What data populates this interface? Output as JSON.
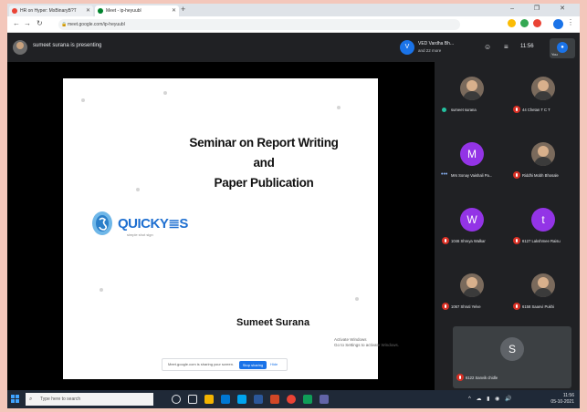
{
  "browser": {
    "tabs": [
      {
        "title": "HR on Hyper: MxBinaryB?T"
      },
      {
        "title": "Meet - ip-heyuubl"
      }
    ],
    "new_tab": "+",
    "window_controls": "– ❐ ✕",
    "address": "meet.google.com/ip-heyuubl"
  },
  "meet": {
    "presenting_text": "sumeet surana is presenting",
    "pinned": {
      "initial": "V",
      "name": "VED Vardha Bh...",
      "sub": "and 22 more"
    },
    "time": "11:56",
    "self_label": "You"
  },
  "slide": {
    "title_lines": [
      "Seminar on Report Writing",
      "and",
      "Paper Publication"
    ],
    "logo_text": "QUICKY≣S",
    "logo_tagline": "simple shot sign",
    "author": "Sumeet Surana",
    "notice_text": "Meet.google.com is sharing your screen.",
    "stop_label": "Stop sharing",
    "hide_label": "Hide",
    "faint_caption": [
      "Activate Windows",
      "Go to Settings to activate Windows."
    ]
  },
  "participants": [
    {
      "name": "sumeet surana",
      "avatar": "photo",
      "indicator": "teal"
    },
    {
      "name": "44 Chetan T C T",
      "avatar": "photo",
      "indicator": "muted"
    },
    {
      "name": "Mrs Sonay Vaishali Pa...",
      "avatar": "M",
      "color": "#9334e6",
      "indicator": "dots"
    },
    {
      "name": "Riddhi Mobh Bhosale",
      "avatar": "photo",
      "indicator": "muted"
    },
    {
      "name": "1046 Shreya Walkar",
      "avatar": "W",
      "color": "#9334e6",
      "indicator": "muted"
    },
    {
      "name": "6127 Lakshmee Raisu",
      "avatar": "t",
      "color": "#9334e6",
      "indicator": "muted"
    },
    {
      "name": "1067 Shruti Yelve",
      "avatar": "photo",
      "indicator": "muted"
    },
    {
      "name": "6158 Saanvi Pukhi",
      "avatar": "photo",
      "indicator": "muted"
    },
    {
      "name": "6122 Sanvik chidle",
      "avatar": "S",
      "color": "#5f6368",
      "indicator": "muted"
    }
  ],
  "taskbar": {
    "search_placeholder": "Type here to search",
    "tray_time": "11:56",
    "tray_date": "05-10-2021"
  }
}
